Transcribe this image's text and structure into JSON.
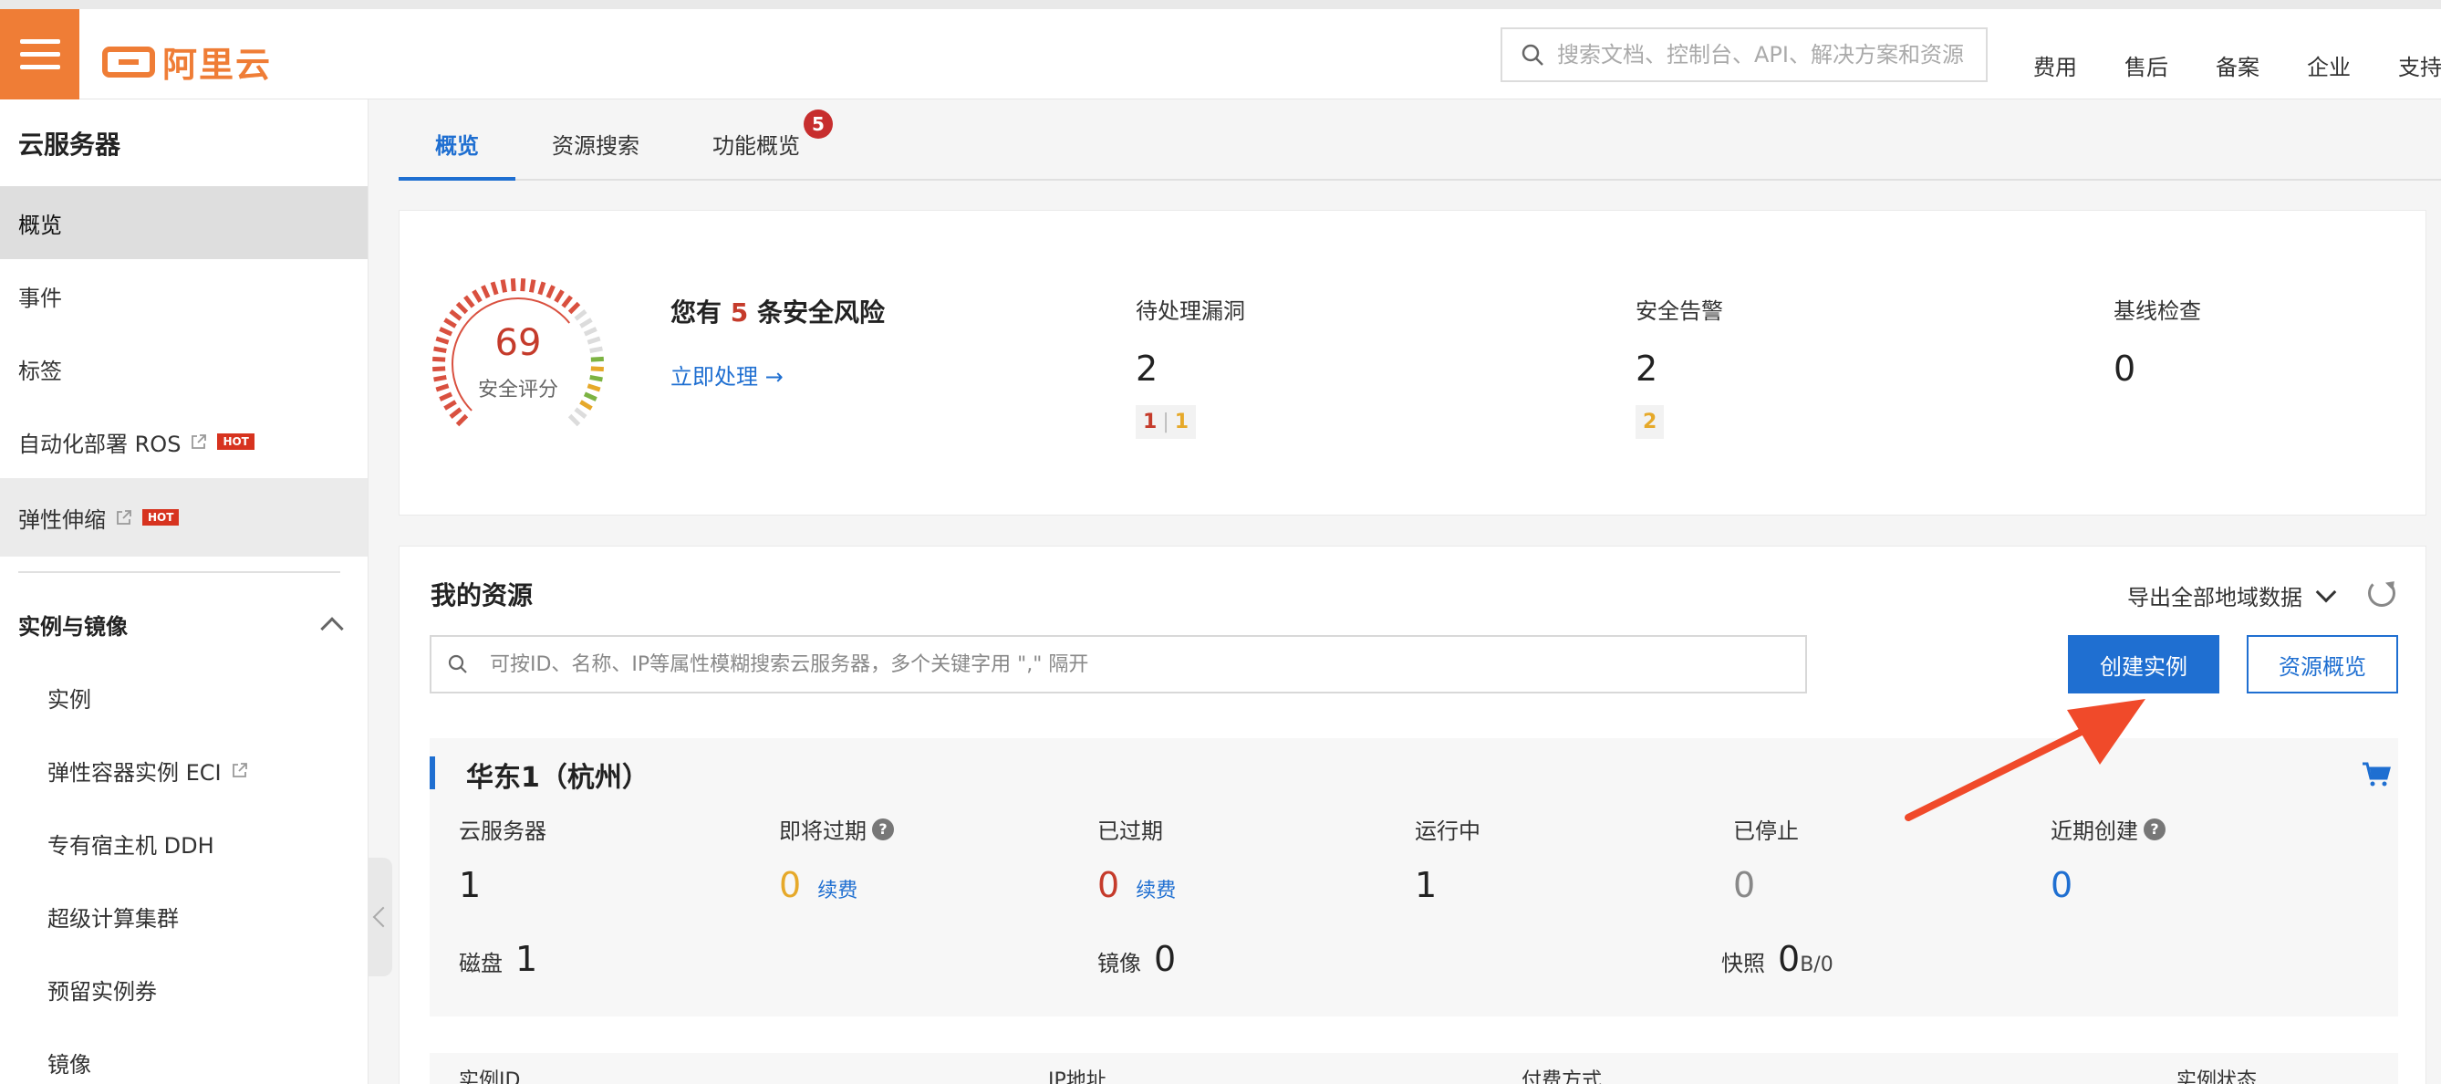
{
  "header": {
    "logo_text": "阿里云",
    "search_placeholder": "搜索文档、控制台、API、解决方案和资源",
    "nav": [
      "费用",
      "售后",
      "备案",
      "企业",
      "支持"
    ]
  },
  "sidebar": {
    "title": "云服务器",
    "items": [
      {
        "label": "概览"
      },
      {
        "label": "事件"
      },
      {
        "label": "标签"
      },
      {
        "label": "自动化部署 ROS",
        "badge": "HOT"
      },
      {
        "label": "弹性伸缩",
        "badge": "HOT"
      }
    ],
    "group": {
      "label": "实例与镜像",
      "items": [
        "实例",
        "弹性容器实例 ECI",
        "专有宿主机 DDH",
        "超级计算集群",
        "预留实例券",
        "镜像"
      ]
    }
  },
  "tabs": [
    {
      "label": "概览"
    },
    {
      "label": "资源搜索"
    },
    {
      "label": "功能概览",
      "badge": "5"
    }
  ],
  "security": {
    "score": "69",
    "score_label": "安全评分",
    "risk_prefix": "您有",
    "risk_count": "5",
    "risk_suffix": "条安全风险",
    "action_link": "立即处理 →",
    "stats": [
      {
        "label": "待处理漏洞",
        "value": "2",
        "chip_red": "1",
        "chip_sep": "|",
        "chip_yellow": "1"
      },
      {
        "label": "安全告警",
        "value": "2",
        "chip_yellow": "2"
      },
      {
        "label": "基线检查",
        "value": "0"
      }
    ]
  },
  "resources": {
    "title": "我的资源",
    "export_label": "导出全部地域数据",
    "search_placeholder": "可按ID、名称、IP等属性模糊搜索云服务器，多个关键字用 \",\" 隔开",
    "create_button": "创建实例",
    "overview_button": "资源概览",
    "region": {
      "name": "华东1（杭州）",
      "stats": [
        {
          "label": "云服务器",
          "value": "1"
        },
        {
          "label": "即将过期",
          "value": "0",
          "renew": "续费"
        },
        {
          "label": "已过期",
          "value": "0",
          "renew": "续费"
        },
        {
          "label": "运行中",
          "value": "1"
        },
        {
          "label": "已停止",
          "value": "0"
        },
        {
          "label": "近期创建",
          "value": "0"
        }
      ],
      "disk_label": "磁盘",
      "disk_value": "1",
      "image_label": "镜像",
      "image_value": "0",
      "snapshot_label": "快照",
      "snapshot_value": "0",
      "snapshot_unit": "B/0"
    },
    "table_headers": [
      "实例ID",
      "IP地址",
      "付费方式",
      "实例状态"
    ]
  },
  "colors": {
    "brand_orange": "#ef7d36",
    "primary_blue": "#1f6fd1",
    "danger_red": "#c53b2b",
    "warning_yellow": "#e6a92a",
    "annotation_arrow": "#f04a2a"
  }
}
